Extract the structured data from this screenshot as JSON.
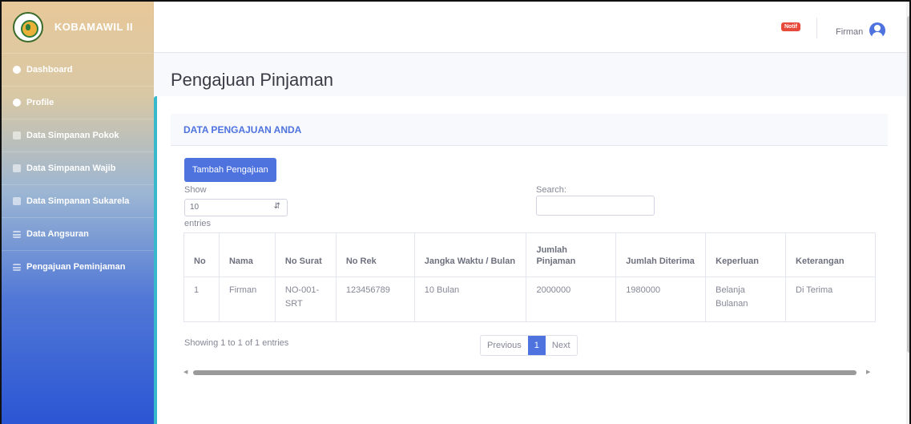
{
  "brand": {
    "name": "KOBAMAWIL II"
  },
  "sidebar": {
    "items": [
      {
        "label": "Dashboard",
        "icon": "dashboard-icon"
      },
      {
        "label": "Profile",
        "icon": "user-icon"
      },
      {
        "label": "Data Simpanan Pokok",
        "icon": "table-icon"
      },
      {
        "label": "Data Simpanan Wajib",
        "icon": "table-icon"
      },
      {
        "label": "Data Simpanan Sukarela",
        "icon": "table-icon"
      },
      {
        "label": "Data Angsuran",
        "icon": "list-icon"
      },
      {
        "label": "Pengajuan Peminjaman",
        "icon": "list-icon"
      }
    ]
  },
  "topbar": {
    "notif_label": "Notif",
    "username": "Firman"
  },
  "page": {
    "title": "Pengajuan Pinjaman"
  },
  "card": {
    "header": "DATA PENGAJUAN ANDA",
    "add_button": "Tambah Pengajuan",
    "show_label": "Show",
    "entries_value": "10",
    "entries_label": "entries",
    "search_label": "Search:",
    "search_value": ""
  },
  "table": {
    "headers": [
      "No",
      "Nama",
      "No Surat",
      "No Rek",
      "Jangka Waktu / Bulan",
      "Jumlah Pinjaman",
      "Jumlah Diterima",
      "Keperluan",
      "Keterangan"
    ],
    "rows": [
      [
        "1",
        "Firman",
        "NO-001-SRT",
        "123456789",
        "10 Bulan",
        "2000000",
        "1980000",
        "Belanja Bulanan",
        "Di Terima"
      ]
    ]
  },
  "pagination": {
    "info": "Showing 1 to 1 of 1 entries",
    "previous": "Previous",
    "current": "1",
    "next": "Next"
  },
  "colors": {
    "primary": "#4e73df",
    "info_border": "#36b9cc",
    "danger": "#e74a3b"
  }
}
